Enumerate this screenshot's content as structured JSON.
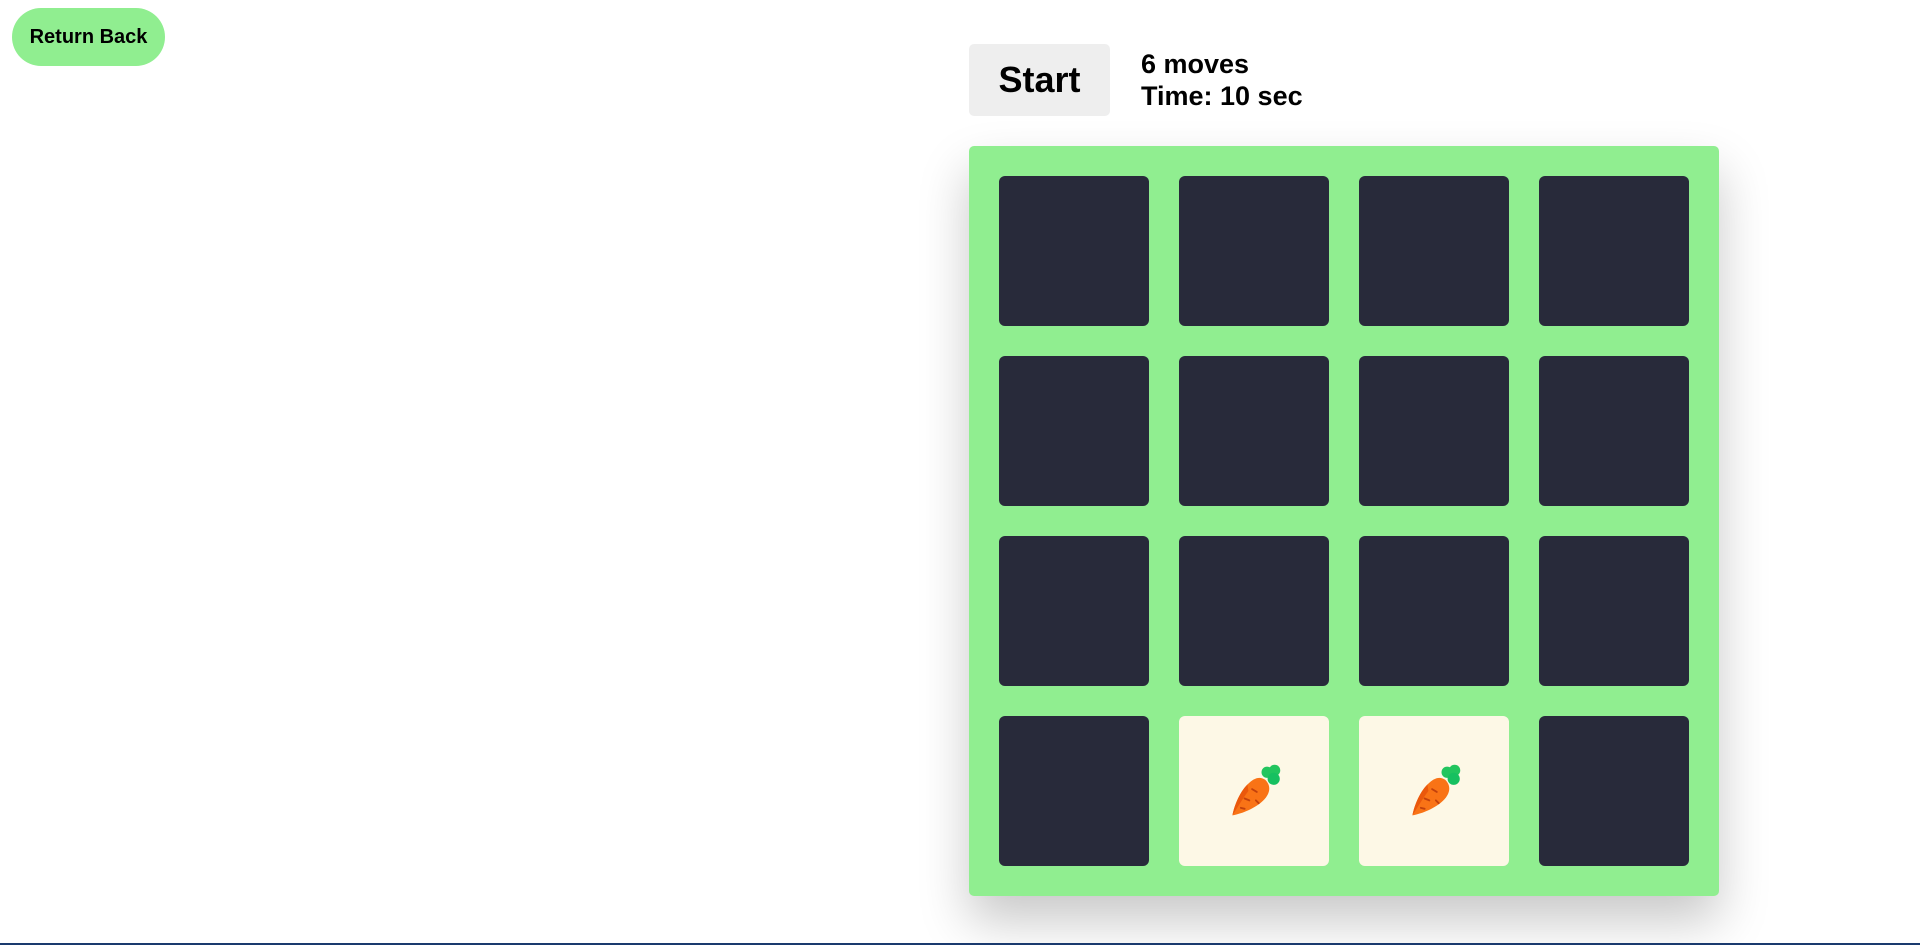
{
  "return_button": {
    "label": "Return Back"
  },
  "controls": {
    "start_label": "Start",
    "moves_text": "6 moves",
    "time_text": "Time: 10 sec"
  },
  "colors": {
    "board": "#90ee90",
    "card_back": "#282a3a",
    "card_front": "#fdf8e6",
    "accent": "#90ee90"
  },
  "board": {
    "rows": 4,
    "columns": 4,
    "cards": [
      {
        "state": "hidden",
        "icon": ""
      },
      {
        "state": "hidden",
        "icon": ""
      },
      {
        "state": "hidden",
        "icon": ""
      },
      {
        "state": "hidden",
        "icon": ""
      },
      {
        "state": "hidden",
        "icon": ""
      },
      {
        "state": "hidden",
        "icon": ""
      },
      {
        "state": "hidden",
        "icon": ""
      },
      {
        "state": "hidden",
        "icon": ""
      },
      {
        "state": "hidden",
        "icon": ""
      },
      {
        "state": "hidden",
        "icon": ""
      },
      {
        "state": "hidden",
        "icon": ""
      },
      {
        "state": "hidden",
        "icon": ""
      },
      {
        "state": "hidden",
        "icon": ""
      },
      {
        "state": "flipped",
        "icon": "carrot-icon"
      },
      {
        "state": "flipped",
        "icon": "carrot-icon"
      },
      {
        "state": "hidden",
        "icon": ""
      }
    ]
  }
}
